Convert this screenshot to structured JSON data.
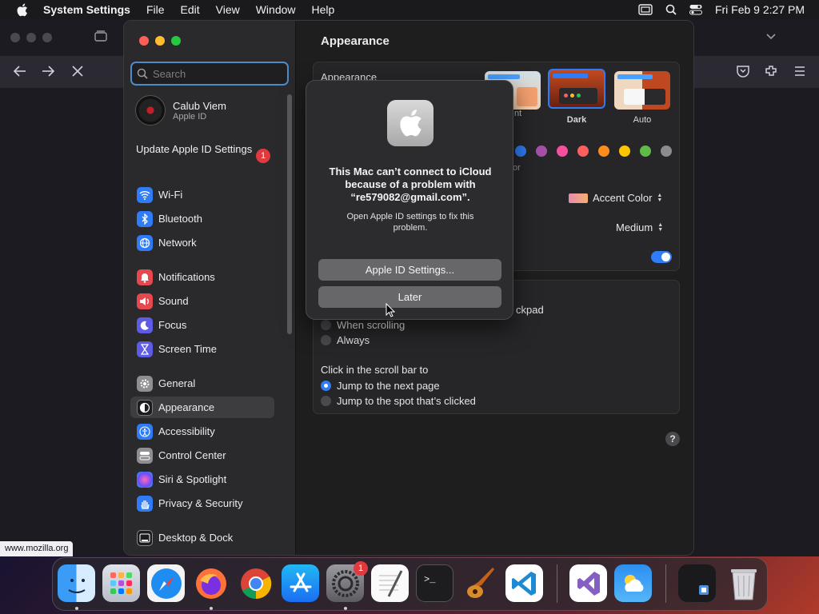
{
  "menubar": {
    "app_name": "System Settings",
    "menus": [
      "File",
      "Edit",
      "View",
      "Window",
      "Help"
    ],
    "clock": "Fri Feb 9  2:27 PM"
  },
  "browser": {
    "status_url": "www.mozilla.org"
  },
  "sidebar": {
    "search_placeholder": "Search",
    "user_name": "Calub Viem",
    "user_sub": "Apple ID",
    "update_label": "Update Apple ID Settings",
    "update_badge": "1",
    "items": [
      {
        "label": "Wi-Fi",
        "icon": "wifi-icon",
        "color": "#2f7cf6"
      },
      {
        "label": "Bluetooth",
        "icon": "bluetooth-icon",
        "color": "#2f7cf6"
      },
      {
        "label": "Network",
        "icon": "globe-icon",
        "color": "#2f7cf6"
      },
      {
        "label": "Notifications",
        "icon": "bell-icon",
        "color": "#e5484d"
      },
      {
        "label": "Sound",
        "icon": "speaker-icon",
        "color": "#e5484d"
      },
      {
        "label": "Focus",
        "icon": "moon-icon",
        "color": "#5e5ce6"
      },
      {
        "label": "Screen Time",
        "icon": "hourglass-icon",
        "color": "#5e5ce6"
      },
      {
        "label": "General",
        "icon": "gear-icon",
        "color": "#8e8e93"
      },
      {
        "label": "Appearance",
        "icon": "appearance-icon",
        "color": "#1c1c1e"
      },
      {
        "label": "Accessibility",
        "icon": "accessibility-icon",
        "color": "#2f7cf6"
      },
      {
        "label": "Control Center",
        "icon": "control-center-icon",
        "color": "#8e8e93"
      },
      {
        "label": "Siri & Spotlight",
        "icon": "siri-icon",
        "color": "#bf5af2"
      },
      {
        "label": "Privacy & Security",
        "icon": "hand-icon",
        "color": "#2f7cf6"
      },
      {
        "label": "Desktop & Dock",
        "icon": "dock-icon",
        "color": "#1c1c1e"
      }
    ]
  },
  "main": {
    "title": "Appearance",
    "appearance_label": "Appearance",
    "appearance_options": [
      "Dark",
      "Auto"
    ],
    "appearance_partial": "nt",
    "accent_partial": "or",
    "accent_popup": "Accent Color",
    "size_popup": "Medium",
    "scroll_partial": "ckpad",
    "scroll_options": [
      "When scrolling",
      "Always"
    ],
    "click_label": "Click in the scroll bar to",
    "click_options": [
      "Jump to the next page",
      "Jump to the spot that’s clicked"
    ],
    "accent_colors": [
      "#2f7cf6",
      "#a550a7",
      "#f74f9e",
      "#fc5f5f",
      "#fd8d1c",
      "#ffc600",
      "#62ba46",
      "#8c8c8c"
    ],
    "help": "?"
  },
  "alert": {
    "heading": "This Mac can’t connect to iCloud because of a problem with “re579082@gmail.com”.",
    "message": "Open Apple ID settings to fix this problem.",
    "primary_button": "Apple ID Settings...",
    "secondary_button": "Later"
  },
  "dock": {
    "apps": [
      "Finder",
      "Launchpad",
      "Safari",
      "Firefox",
      "Chrome",
      "App Store",
      "System Settings",
      "TextEdit",
      "Terminal",
      "GarageBand",
      "Visual Studio Code",
      "Visual Studio",
      "Weather",
      "Downloads",
      "Trash"
    ],
    "settings_badge": "1"
  }
}
